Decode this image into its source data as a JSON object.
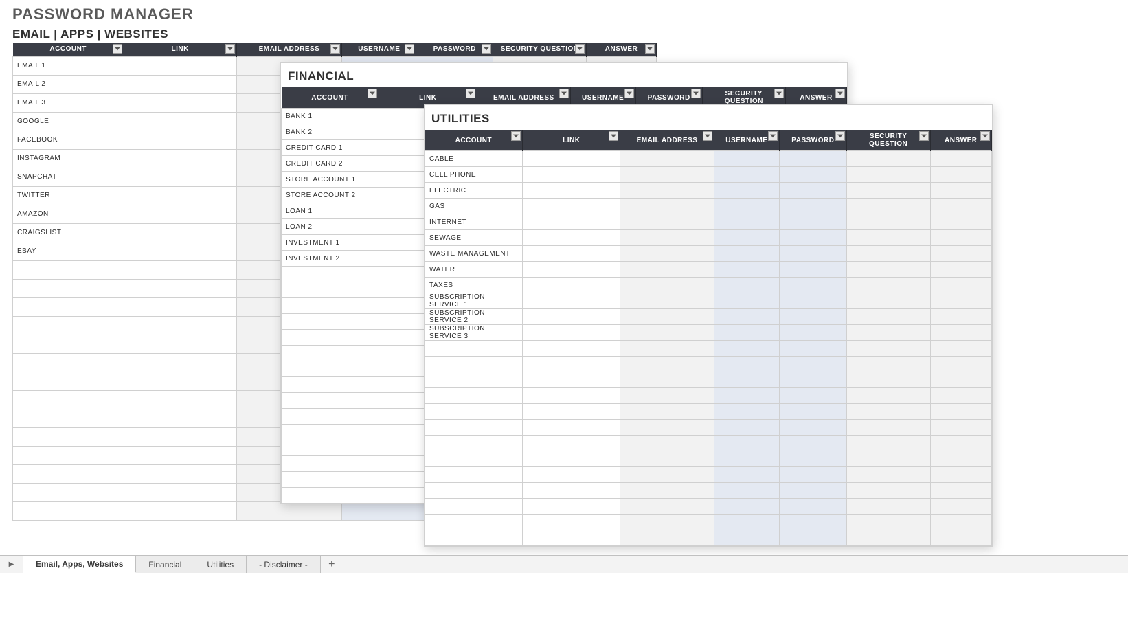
{
  "title": "PASSWORD MANAGER",
  "subtitle": "EMAIL  |  APPS  |  WEBSITES",
  "columns": [
    "ACCOUNT",
    "LINK",
    "EMAIL ADDRESS",
    "USERNAME",
    "PASSWORD",
    "SECURITY QUESTION",
    "ANSWER"
  ],
  "sheet1": {
    "rows": [
      "EMAIL 1",
      "EMAIL 2",
      "EMAIL 3",
      "GOOGLE",
      "FACEBOOK",
      "INSTAGRAM",
      "SNAPCHAT",
      "TWITTER",
      "AMAZON",
      "CRAIGSLIST",
      "EBAY"
    ],
    "blank_rows": 14
  },
  "sheet2": {
    "title": "FINANCIAL",
    "rows": [
      "BANK 1",
      "BANK 2",
      "CREDIT CARD 1",
      "CREDIT CARD 2",
      "STORE ACCOUNT 1",
      "STORE ACCOUNT 2",
      "LOAN 1",
      "LOAN 2",
      "INVESTMENT 1",
      "INVESTMENT 2"
    ],
    "blank_rows": 15
  },
  "sheet3": {
    "title": "UTILITIES",
    "rows": [
      "CABLE",
      "CELL PHONE",
      "ELECTRIC",
      "GAS",
      "INTERNET",
      "SEWAGE",
      "WASTE MANAGEMENT",
      "WATER",
      "TAXES",
      "SUBSCRIPTION SERVICE 1",
      "SUBSCRIPTION SERVICE 2",
      "SUBSCRIPTION SERVICE 3"
    ],
    "blank_rows": 13
  },
  "tabs": {
    "items": [
      "Email, Apps, Websites",
      "Financial",
      "Utilities",
      "- Disclaimer -"
    ],
    "active": 0,
    "add": "+"
  }
}
